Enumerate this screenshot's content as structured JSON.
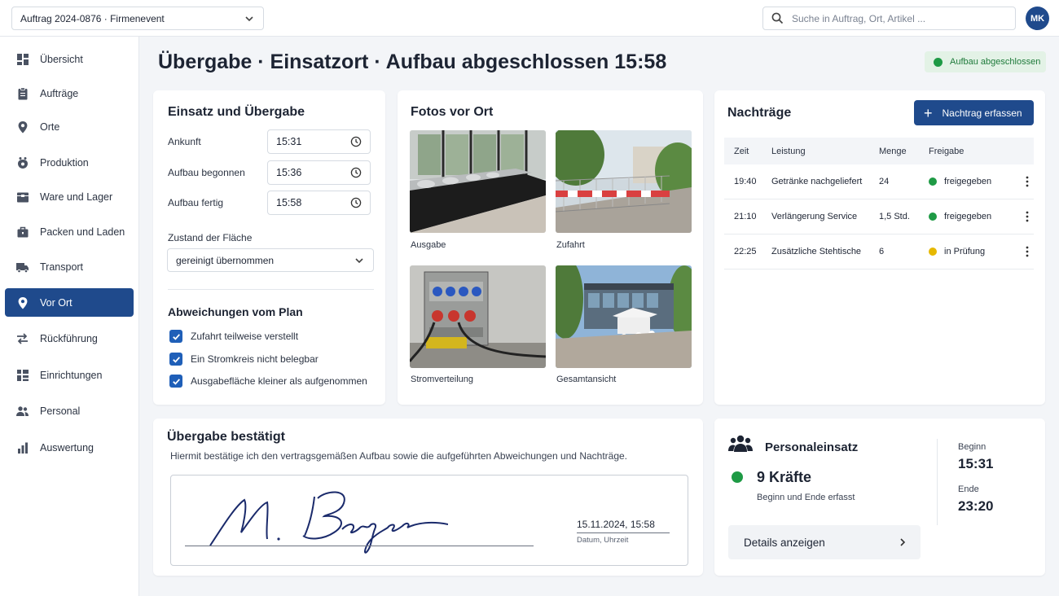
{
  "topbar": {
    "order_select": "Auftrag 2024-0876 · Firmenevent",
    "search_placeholder": "Suche in Auftrag, Ort, Artikel ...",
    "avatar_initials": "MK"
  },
  "sidebar": {
    "items": [
      {
        "label": "Übersicht",
        "icon": "grid-icon"
      },
      {
        "label": "Aufträge",
        "icon": "clipboard-icon"
      },
      {
        "label": "Orte",
        "icon": "location-pin-icon"
      },
      {
        "label": "Produktion",
        "icon": "production-icon"
      },
      {
        "label": "Ware und Lager",
        "icon": "warehouse-icon"
      },
      {
        "label": "Packen und Laden",
        "icon": "briefcase-icon"
      },
      {
        "label": "Transport",
        "icon": "truck-icon"
      },
      {
        "label": "Vor Ort",
        "icon": "location-pin-icon",
        "active": true
      },
      {
        "label": "Rückführung",
        "icon": "swap-icon"
      },
      {
        "label": "Einrichtungen",
        "icon": "layout-icon"
      },
      {
        "label": "Personal",
        "icon": "people-icon"
      },
      {
        "label": "Auswertung",
        "icon": "bar-chart-icon"
      }
    ]
  },
  "header": {
    "title": "Übergabe · Einsatzort · Aufbau abgeschlossen 15:58",
    "status": "Aufbau abgeschlossen"
  },
  "einsatz": {
    "title": "Einsatz und Übergabe",
    "ankunft_label": "Ankunft",
    "ankunft_value": "15:31",
    "begonnen_label": "Aufbau begonnen",
    "begonnen_value": "15:36",
    "fertig_label": "Aufbau fertig",
    "fertig_value": "15:58",
    "zustand_label": "Zustand der Fläche",
    "zustand_value": "gereinigt übernommen",
    "abweichungen_title": "Abweichungen vom Plan",
    "abweichungen": [
      "Zufahrt teilweise verstellt",
      "Ein Stromkreis nicht belegbar",
      "Ausgabefläche kleiner als aufgenommen"
    ]
  },
  "fotos": {
    "title": "Fotos vor Ort",
    "items": [
      "Ausgabe",
      "Zufahrt",
      "Stromverteilung",
      "Gesamtansicht"
    ]
  },
  "nachtraege": {
    "title": "Nachträge",
    "add_button": "Nachtrag erfassen",
    "columns": [
      "Zeit",
      "Leistung",
      "Menge",
      "Freigabe"
    ],
    "rows": [
      {
        "zeit": "19:40",
        "leistung": "Getränke nachgeliefert",
        "menge": "24",
        "freigabe": "freigegeben",
        "status_color": "#1e9a45"
      },
      {
        "zeit": "21:10",
        "leistung": "Verlängerung Service",
        "menge": "1,5 Std.",
        "freigabe": "freigegeben",
        "status_color": "#1e9a45"
      },
      {
        "zeit": "22:25",
        "leistung": "Zusätzliche Stehtische",
        "menge": "6",
        "freigabe": "in Prüfung",
        "status_color": "#e6b800"
      }
    ]
  },
  "uebergabe": {
    "title": "Übergabe bestätigt",
    "text": "Hiermit bestätige ich den vertragsgemäßen Aufbau sowie die aufgeführten Abweichungen und Nachträge.",
    "date_value": "15.11.2024, 15:58",
    "date_label": "Datum, Uhrzeit",
    "signature": "M. Berger"
  },
  "personal": {
    "title": "Personaleinsatz",
    "count": "9 Kräfte",
    "subtitle": "Beginn und Ende erfasst",
    "details_button": "Details anzeigen",
    "beginn_label": "Beginn",
    "beginn_value": "15:31",
    "ende_label": "Ende",
    "ende_value": "23:20"
  },
  "colors": {
    "primary": "#1f4a8c",
    "success": "#1e9a45",
    "warning": "#e6b800"
  }
}
